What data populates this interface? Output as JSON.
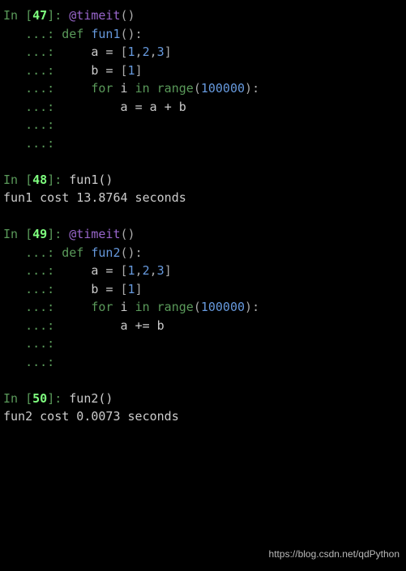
{
  "cells": [
    {
      "prompt_num": "47",
      "lines": [
        {
          "type": "in",
          "tokens": [
            {
              "cls": "decorator",
              "t": "@timeit"
            },
            {
              "cls": "paren",
              "t": "()"
            }
          ]
        },
        {
          "type": "cont",
          "tokens": [
            {
              "cls": "keyword-def",
              "t": "def "
            },
            {
              "cls": "func-name",
              "t": "fun1"
            },
            {
              "cls": "paren",
              "t": "()"
            },
            {
              "cls": "colon",
              "t": ":"
            }
          ]
        },
        {
          "type": "cont",
          "tokens": [
            {
              "cls": "var",
              "t": "    a "
            },
            {
              "cls": "op",
              "t": "= "
            },
            {
              "cls": "bracket-lit",
              "t": "["
            },
            {
              "cls": "number",
              "t": "1"
            },
            {
              "cls": "comma",
              "t": ","
            },
            {
              "cls": "number",
              "t": "2"
            },
            {
              "cls": "comma",
              "t": ","
            },
            {
              "cls": "number",
              "t": "3"
            },
            {
              "cls": "bracket-lit",
              "t": "]"
            }
          ]
        },
        {
          "type": "cont",
          "tokens": [
            {
              "cls": "var",
              "t": "    b "
            },
            {
              "cls": "op",
              "t": "= "
            },
            {
              "cls": "bracket-lit",
              "t": "["
            },
            {
              "cls": "number",
              "t": "1"
            },
            {
              "cls": "bracket-lit",
              "t": "]"
            }
          ]
        },
        {
          "type": "cont",
          "tokens": [
            {
              "cls": "var",
              "t": "    "
            },
            {
              "cls": "keyword-for",
              "t": "for "
            },
            {
              "cls": "var",
              "t": "i "
            },
            {
              "cls": "keyword-in",
              "t": "in "
            },
            {
              "cls": "builtin",
              "t": "range"
            },
            {
              "cls": "paren",
              "t": "("
            },
            {
              "cls": "number",
              "t": "100000"
            },
            {
              "cls": "paren",
              "t": ")"
            },
            {
              "cls": "colon",
              "t": ":"
            }
          ]
        },
        {
          "type": "cont",
          "tokens": [
            {
              "cls": "var",
              "t": "        a "
            },
            {
              "cls": "op",
              "t": "= "
            },
            {
              "cls": "var",
              "t": "a "
            },
            {
              "cls": "op",
              "t": "+ "
            },
            {
              "cls": "var",
              "t": "b"
            }
          ]
        },
        {
          "type": "cont",
          "tokens": []
        },
        {
          "type": "cont",
          "tokens": []
        }
      ]
    },
    {
      "type": "blank"
    },
    {
      "prompt_num": "48",
      "lines": [
        {
          "type": "in",
          "tokens": [
            {
              "cls": "call",
              "t": "fun1()"
            }
          ]
        }
      ],
      "output": "fun1 cost 13.8764 seconds"
    },
    {
      "type": "blank"
    },
    {
      "prompt_num": "49",
      "lines": [
        {
          "type": "in",
          "tokens": [
            {
              "cls": "decorator",
              "t": "@timeit"
            },
            {
              "cls": "paren",
              "t": "()"
            }
          ]
        },
        {
          "type": "cont",
          "tokens": [
            {
              "cls": "keyword-def",
              "t": "def "
            },
            {
              "cls": "func-name",
              "t": "fun2"
            },
            {
              "cls": "paren",
              "t": "()"
            },
            {
              "cls": "colon",
              "t": ":"
            }
          ]
        },
        {
          "type": "cont",
          "tokens": [
            {
              "cls": "var",
              "t": "    a "
            },
            {
              "cls": "op",
              "t": "= "
            },
            {
              "cls": "bracket-lit",
              "t": "["
            },
            {
              "cls": "number",
              "t": "1"
            },
            {
              "cls": "comma",
              "t": ","
            },
            {
              "cls": "number",
              "t": "2"
            },
            {
              "cls": "comma",
              "t": ","
            },
            {
              "cls": "number",
              "t": "3"
            },
            {
              "cls": "bracket-lit",
              "t": "]"
            }
          ]
        },
        {
          "type": "cont",
          "tokens": [
            {
              "cls": "var",
              "t": "    b "
            },
            {
              "cls": "op",
              "t": "= "
            },
            {
              "cls": "bracket-lit",
              "t": "["
            },
            {
              "cls": "number",
              "t": "1"
            },
            {
              "cls": "bracket-lit",
              "t": "]"
            }
          ]
        },
        {
          "type": "cont",
          "tokens": [
            {
              "cls": "var",
              "t": "    "
            },
            {
              "cls": "keyword-for",
              "t": "for "
            },
            {
              "cls": "var",
              "t": "i "
            },
            {
              "cls": "keyword-in",
              "t": "in "
            },
            {
              "cls": "builtin",
              "t": "range"
            },
            {
              "cls": "paren",
              "t": "("
            },
            {
              "cls": "number",
              "t": "100000"
            },
            {
              "cls": "paren",
              "t": ")"
            },
            {
              "cls": "colon",
              "t": ":"
            }
          ]
        },
        {
          "type": "cont",
          "tokens": [
            {
              "cls": "var",
              "t": "        a "
            },
            {
              "cls": "op",
              "t": "+= "
            },
            {
              "cls": "var",
              "t": "b"
            }
          ]
        },
        {
          "type": "cont",
          "tokens": []
        },
        {
          "type": "cont",
          "tokens": []
        }
      ]
    },
    {
      "type": "blank"
    },
    {
      "prompt_num": "50",
      "lines": [
        {
          "type": "in",
          "tokens": [
            {
              "cls": "call",
              "t": "fun2()"
            }
          ]
        }
      ],
      "output": "fun2 cost 0.0073 seconds"
    }
  ],
  "prompt_label": "In ",
  "cont_label": "   ...: ",
  "watermark": "https://blog.csdn.net/qdPython"
}
